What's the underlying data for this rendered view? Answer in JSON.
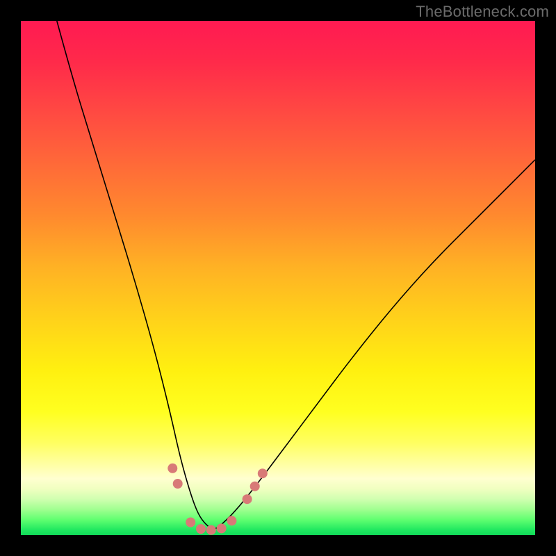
{
  "watermark": "TheBottleneck.com",
  "chart_data": {
    "type": "line",
    "title": "",
    "xlabel": "",
    "ylabel": "",
    "xlim": [
      0,
      100
    ],
    "ylim": [
      0,
      100
    ],
    "grid": false,
    "series": [
      {
        "name": "bottleneck-curve",
        "x": [
          7,
          10,
          14,
          18,
          22,
          26,
          29,
          31,
          33,
          34.5,
          36,
          37.5,
          39,
          42,
          46,
          52,
          58,
          64,
          72,
          80,
          88,
          96,
          100
        ],
        "y": [
          100,
          89,
          76,
          63,
          50,
          36,
          24,
          15,
          8,
          4,
          2,
          1,
          2,
          5,
          10,
          18,
          26,
          34,
          44,
          53,
          61,
          69,
          73
        ],
        "stroke": "#000000",
        "stroke_width": 1.6
      }
    ],
    "markers": {
      "name": "data-points",
      "fill": "#d87a77",
      "radius": 7,
      "points": [
        {
          "x": 29.5,
          "y": 13
        },
        {
          "x": 30.5,
          "y": 10
        },
        {
          "x": 33.0,
          "y": 2.5
        },
        {
          "x": 35.0,
          "y": 1.2
        },
        {
          "x": 37.0,
          "y": 1.0
        },
        {
          "x": 39.0,
          "y": 1.3
        },
        {
          "x": 41.0,
          "y": 2.8
        },
        {
          "x": 44.0,
          "y": 7
        },
        {
          "x": 45.5,
          "y": 9.5
        },
        {
          "x": 47.0,
          "y": 12
        }
      ]
    },
    "background_gradient": {
      "type": "vertical",
      "stops": [
        {
          "pos": 0.0,
          "color": "#ff1a52"
        },
        {
          "pos": 0.38,
          "color": "#ff8a2e"
        },
        {
          "pos": 0.68,
          "color": "#fff010"
        },
        {
          "pos": 0.88,
          "color": "#ffffc0"
        },
        {
          "pos": 1.0,
          "color": "#10d858"
        }
      ]
    }
  }
}
